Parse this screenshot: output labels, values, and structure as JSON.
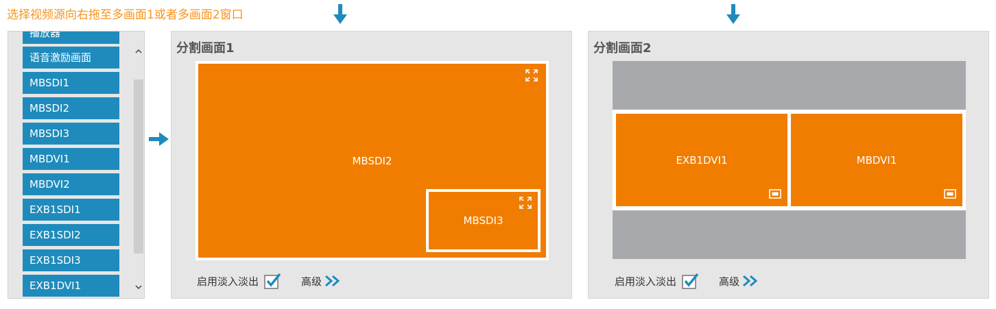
{
  "instruction": "选择视频源向右拖至多画面1或者多画面2窗口",
  "sources": [
    {
      "label": "播放器"
    },
    {
      "label": "语音激励画面"
    },
    {
      "label": "MBSDI1"
    },
    {
      "label": "MBSDI2"
    },
    {
      "label": "MBSDI3"
    },
    {
      "label": "MBDVI1"
    },
    {
      "label": "MBDVI2"
    },
    {
      "label": "EXB1SDI1"
    },
    {
      "label": "EXB1SDI2"
    },
    {
      "label": "EXB1SDI3"
    },
    {
      "label": "EXB1DVI1"
    }
  ],
  "layout1": {
    "title": "分割画面1",
    "main_window": "MBSDI2",
    "pip_window": "MBSDI3",
    "fade_label": "启用淡入淡出",
    "fade_checked": true,
    "advanced_label": "高级"
  },
  "layout2": {
    "title": "分割画面2",
    "left_window": "EXB1DVI1",
    "right_window": "MBDVI1",
    "fade_label": "启用淡入淡出",
    "fade_checked": true,
    "advanced_label": "高级"
  },
  "colors": {
    "accent_orange": "#f07d00",
    "source_blue": "#1f8bbc",
    "arrow_blue": "#1f8bbc",
    "instruction_orange": "#f7941d",
    "empty_slot_gray": "#a7a9ac"
  },
  "icons": {
    "down_arrow": "arrow-down-icon",
    "right_arrow": "arrow-right-icon",
    "maximize": "maximize-icon",
    "restore": "window-restore-icon",
    "checkbox": "checkbox-checked-icon",
    "advanced": "double-chevron-right-icon"
  }
}
